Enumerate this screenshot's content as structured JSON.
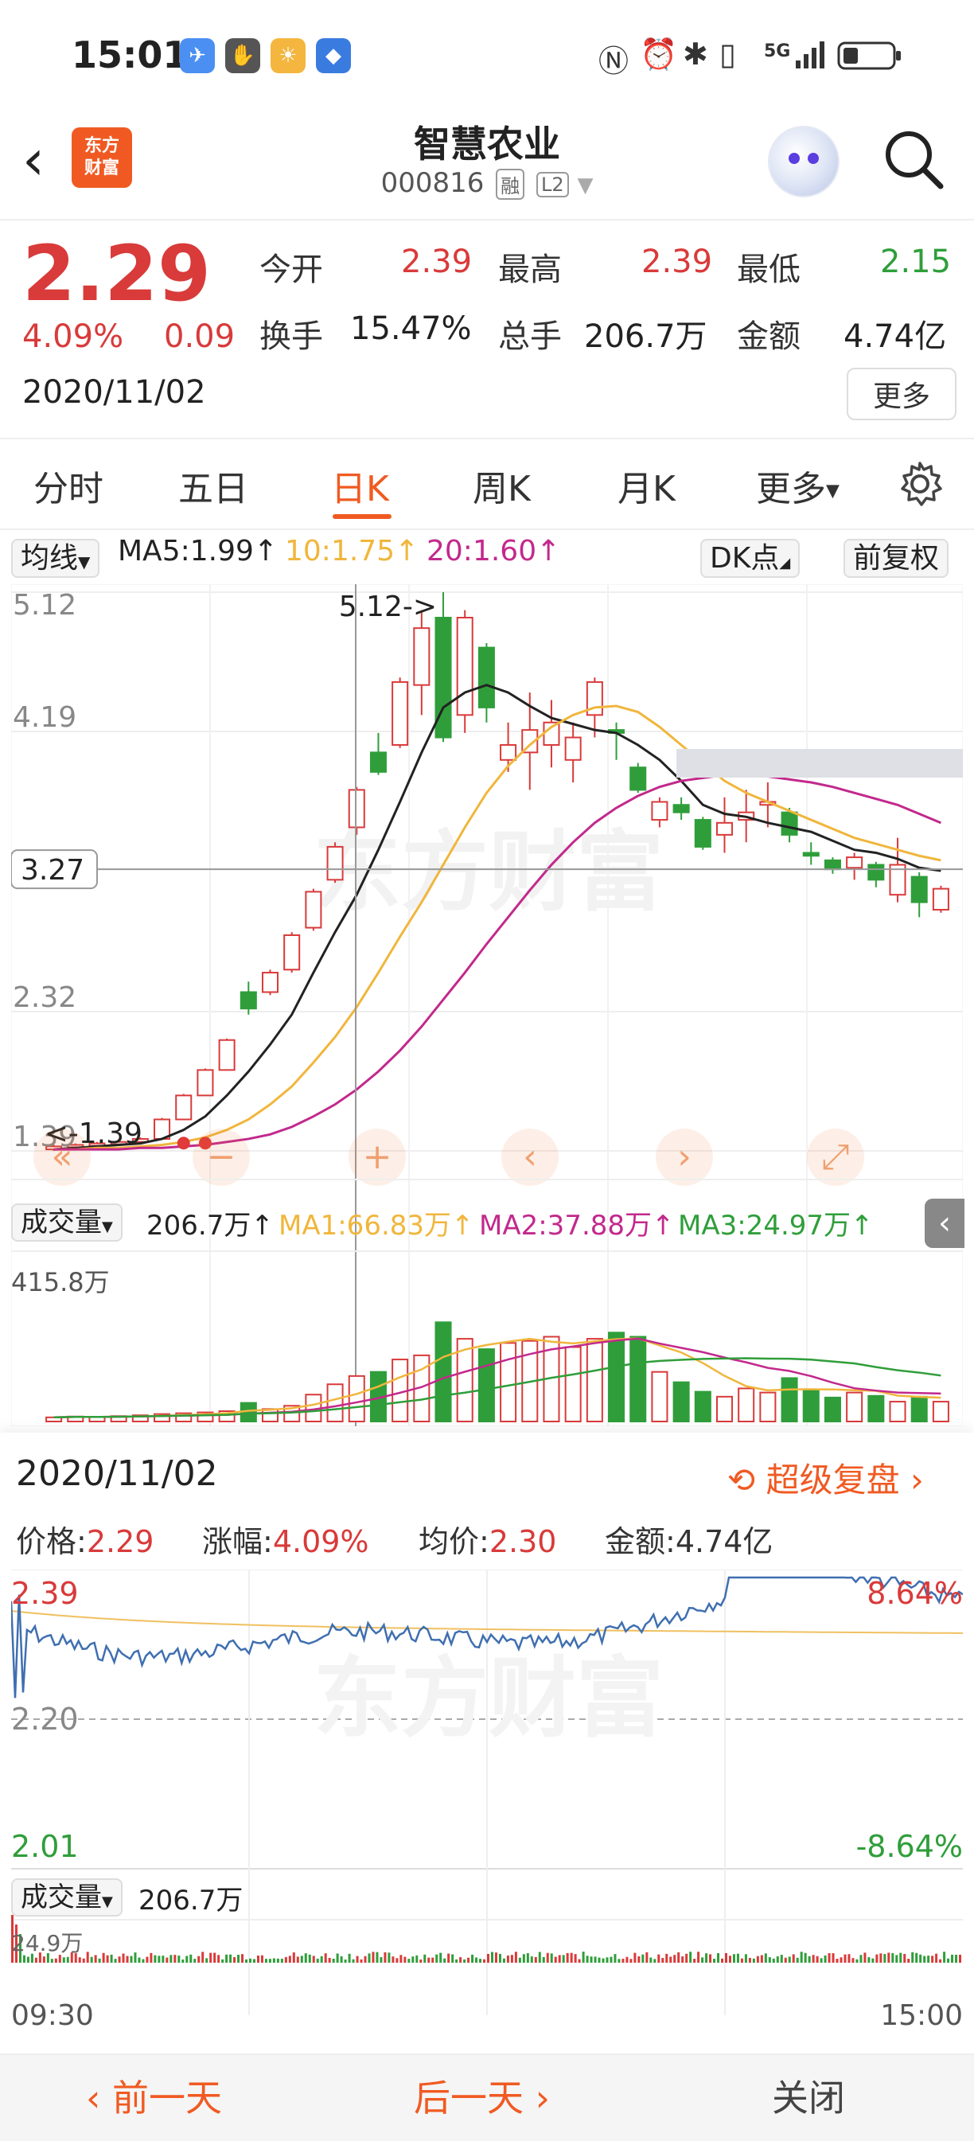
{
  "status": {
    "time": "15:01",
    "network": "5G"
  },
  "header": {
    "logo_text": "东方财富",
    "stock_name": "智慧农业",
    "stock_code": "000816",
    "tag_rong": "融",
    "tag_l2": "L2"
  },
  "quote": {
    "price": "2.29",
    "change_pct": "4.09%",
    "change_abs": "0.09",
    "date": "2020/11/02",
    "open_label": "今开",
    "open": "2.39",
    "high_label": "最高",
    "high": "2.39",
    "low_label": "最低",
    "low": "2.15",
    "turnover_label": "换手",
    "turnover": "15.47%",
    "volume_label": "总手",
    "volume": "206.7万",
    "amount_label": "金额",
    "amount": "4.74亿",
    "more_label": "更多"
  },
  "tabs": [
    {
      "label": "分时"
    },
    {
      "label": "五日"
    },
    {
      "label": "日K"
    },
    {
      "label": "周K"
    },
    {
      "label": "月K"
    },
    {
      "label": "更多"
    }
  ],
  "ma_bar": {
    "selector": "均线",
    "ma5": "MA5:1.99↑",
    "ma10": "10:1.75↑",
    "ma20": "20:1.60↑",
    "dk": "DK点",
    "adjust": "前复权"
  },
  "kchart": {
    "y_labels": [
      "5.12",
      "4.19",
      "3.27",
      "2.32",
      "1.39"
    ],
    "high_annotation": "5.12->",
    "low_annotation": "<-1.39",
    "crosshair_value": "3.27",
    "watermark": "东方财富",
    "colors": {
      "up": "#d93a3a",
      "down": "#2f9e3a",
      "ma5": "#222222",
      "ma10": "#f0b63c",
      "ma20": "#c2298c"
    }
  },
  "volume_bar": {
    "selector": "成交量",
    "value": "206.7万↑",
    "ma1": "MA1:66.83万↑",
    "ma2": "MA2:37.88万↑",
    "ma3": "MA3:24.97万↑",
    "max_label": "415.8万"
  },
  "detail": {
    "date": "2020/11/02",
    "replay_label": "超级复盘",
    "price_label": "价格:",
    "price": "2.29",
    "chg_label": "涨幅:",
    "chg": "4.09%",
    "avg_label": "均价:",
    "avg": "2.30",
    "amount_label": "金额:",
    "amount": "4.74亿",
    "y_top": "2.39",
    "y_mid": "2.20",
    "y_bottom": "2.01",
    "pct_top": "8.64%",
    "pct_bottom": "-8.64%",
    "vol_selector": "成交量",
    "vol_value": "206.7万",
    "vol_max": "24.9万",
    "time_start": "09:30",
    "time_end": "15:00"
  },
  "bottom": {
    "prev": "前一天",
    "next": "后一天",
    "close": "关闭"
  },
  "chart_data": {
    "type": "candlestick",
    "title": "",
    "ylim": [
      1.39,
      5.12
    ],
    "candles": [
      {
        "o": 1.4,
        "c": 1.42,
        "h": 1.43,
        "l": 1.39
      },
      {
        "o": 1.42,
        "c": 1.43,
        "h": 1.44,
        "l": 1.41
      },
      {
        "o": 1.43,
        "c": 1.44,
        "h": 1.45,
        "l": 1.42
      },
      {
        "o": 1.44,
        "c": 1.45,
        "h": 1.46,
        "l": 1.43
      },
      {
        "o": 1.45,
        "c": 1.47,
        "h": 1.48,
        "l": 1.44
      },
      {
        "o": 1.47,
        "c": 1.6,
        "h": 1.61,
        "l": 1.47
      },
      {
        "o": 1.6,
        "c": 1.76,
        "h": 1.77,
        "l": 1.6
      },
      {
        "o": 1.76,
        "c": 1.93,
        "h": 1.94,
        "l": 1.76
      },
      {
        "o": 1.93,
        "c": 2.13,
        "h": 2.14,
        "l": 1.93
      },
      {
        "o": 2.45,
        "c": 2.34,
        "h": 2.52,
        "l": 2.3
      },
      {
        "o": 2.45,
        "c": 2.58,
        "h": 2.6,
        "l": 2.43
      },
      {
        "o": 2.6,
        "c": 2.83,
        "h": 2.85,
        "l": 2.58
      },
      {
        "o": 2.88,
        "c": 3.12,
        "h": 3.14,
        "l": 2.86
      },
      {
        "o": 3.2,
        "c": 3.42,
        "h": 3.45,
        "l": 3.18
      },
      {
        "o": 3.55,
        "c": 3.8,
        "h": 3.82,
        "l": 3.5
      },
      {
        "o": 4.05,
        "c": 3.92,
        "h": 4.18,
        "l": 3.9
      },
      {
        "o": 4.1,
        "c": 4.52,
        "h": 4.55,
        "l": 4.08
      },
      {
        "o": 4.5,
        "c": 4.88,
        "h": 5.0,
        "l": 4.3
      },
      {
        "o": 4.95,
        "c": 4.15,
        "h": 5.12,
        "l": 4.12
      },
      {
        "o": 4.3,
        "c": 4.95,
        "h": 5.0,
        "l": 4.18
      },
      {
        "o": 4.75,
        "c": 4.35,
        "h": 4.78,
        "l": 4.25
      },
      {
        "o": 4.0,
        "c": 4.1,
        "h": 4.25,
        "l": 3.92
      },
      {
        "o": 4.05,
        "c": 4.2,
        "h": 4.45,
        "l": 3.8
      },
      {
        "o": 4.1,
        "c": 4.25,
        "h": 4.4,
        "l": 3.95
      },
      {
        "o": 4.0,
        "c": 4.15,
        "h": 4.25,
        "l": 3.85
      },
      {
        "o": 4.3,
        "c": 4.52,
        "h": 4.55,
        "l": 4.15
      },
      {
        "o": 4.2,
        "c": 4.18,
        "h": 4.25,
        "l": 4.0
      },
      {
        "o": 3.95,
        "c": 3.8,
        "h": 3.98,
        "l": 3.78
      },
      {
        "o": 3.6,
        "c": 3.72,
        "h": 3.75,
        "l": 3.55
      },
      {
        "o": 3.7,
        "c": 3.65,
        "h": 3.75,
        "l": 3.6
      },
      {
        "o": 3.6,
        "c": 3.42,
        "h": 3.62,
        "l": 3.4
      },
      {
        "o": 3.5,
        "c": 3.58,
        "h": 3.75,
        "l": 3.38
      },
      {
        "o": 3.6,
        "c": 3.65,
        "h": 3.8,
        "l": 3.45
      },
      {
        "o": 3.7,
        "c": 3.72,
        "h": 3.85,
        "l": 3.55
      },
      {
        "o": 3.65,
        "c": 3.5,
        "h": 3.68,
        "l": 3.45
      },
      {
        "o": 3.38,
        "c": 3.36,
        "h": 3.45,
        "l": 3.3
      },
      {
        "o": 3.33,
        "c": 3.27,
        "h": 3.35,
        "l": 3.24
      },
      {
        "o": 3.28,
        "c": 3.35,
        "h": 3.38,
        "l": 3.2
      },
      {
        "o": 3.3,
        "c": 3.2,
        "h": 3.32,
        "l": 3.15
      },
      {
        "o": 3.1,
        "c": 3.3,
        "h": 3.48,
        "l": 3.05
      },
      {
        "o": 3.22,
        "c": 3.05,
        "h": 3.25,
        "l": 2.95
      },
      {
        "o": 3.0,
        "c": 3.14,
        "h": 3.16,
        "l": 2.98
      }
    ],
    "ma5": [
      1.4,
      1.41,
      1.42,
      1.43,
      1.44,
      1.47,
      1.53,
      1.62,
      1.76,
      1.92,
      2.1,
      2.3,
      2.58,
      2.85,
      3.1,
      3.4,
      3.72,
      4.05,
      4.35,
      4.45,
      4.5,
      4.45,
      4.36,
      4.28,
      4.24,
      4.2,
      4.18,
      4.1,
      4.0,
      3.86,
      3.7,
      3.64,
      3.62,
      3.58,
      3.55,
      3.52,
      3.46,
      3.4,
      3.38,
      3.34,
      3.28,
      3.26
    ],
    "ma10": [
      1.4,
      1.4,
      1.41,
      1.41,
      1.42,
      1.43,
      1.45,
      1.48,
      1.53,
      1.6,
      1.7,
      1.82,
      1.98,
      2.15,
      2.35,
      2.58,
      2.82,
      3.05,
      3.3,
      3.55,
      3.78,
      3.96,
      4.1,
      4.22,
      4.3,
      4.35,
      4.36,
      4.32,
      4.22,
      4.1,
      3.98,
      3.86,
      3.78,
      3.72,
      3.66,
      3.6,
      3.54,
      3.48,
      3.44,
      3.4,
      3.36,
      3.33
    ],
    "ma20": [
      1.4,
      1.4,
      1.4,
      1.4,
      1.41,
      1.41,
      1.42,
      1.43,
      1.45,
      1.47,
      1.5,
      1.55,
      1.62,
      1.7,
      1.8,
      1.92,
      2.06,
      2.22,
      2.4,
      2.58,
      2.77,
      2.95,
      3.13,
      3.3,
      3.45,
      3.58,
      3.68,
      3.76,
      3.82,
      3.86,
      3.88,
      3.9,
      3.9,
      3.89,
      3.87,
      3.85,
      3.82,
      3.78,
      3.74,
      3.7,
      3.64,
      3.58
    ],
    "volume_ylim": [
      0,
      415.8
    ],
    "volume": [
      10,
      12,
      11,
      13,
      15,
      18,
      20,
      22,
      25,
      45,
      30,
      38,
      65,
      90,
      110,
      120,
      150,
      160,
      240,
      200,
      175,
      190,
      195,
      205,
      180,
      200,
      215,
      205,
      120,
      95,
      72,
      60,
      80,
      70,
      105,
      75,
      58,
      70,
      62,
      48,
      60,
      48
    ]
  }
}
